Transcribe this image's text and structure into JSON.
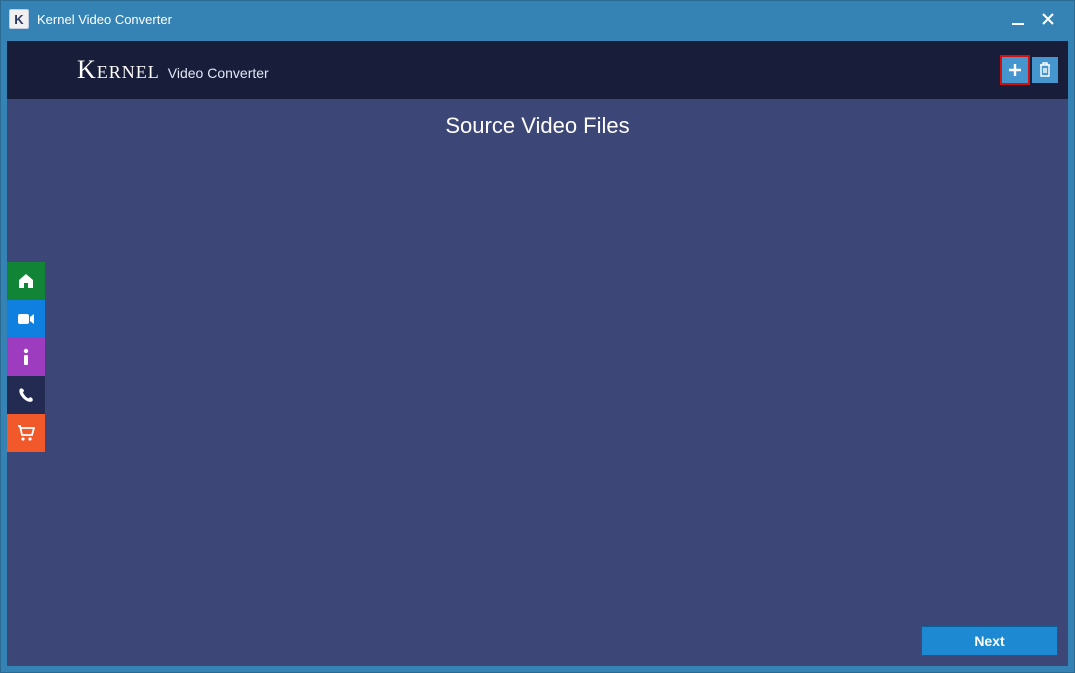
{
  "window": {
    "app_icon_letter": "K",
    "title": "Kernel Video Converter"
  },
  "header": {
    "brand_main": "Kernel",
    "brand_sub": "Video Converter",
    "add_tooltip": "Add files",
    "delete_tooltip": "Delete files"
  },
  "main": {
    "section_title": "Source Video Files"
  },
  "sidebar": {
    "items": [
      {
        "name": "home",
        "color": "green"
      },
      {
        "name": "video",
        "color": "blue"
      },
      {
        "name": "info",
        "color": "purple"
      },
      {
        "name": "support",
        "color": "dark"
      },
      {
        "name": "buy",
        "color": "orange"
      }
    ]
  },
  "footer": {
    "next_label": "Next"
  },
  "colors": {
    "title_bar": "#3583b5",
    "header": "#181d3a",
    "body": "#3d4777",
    "primary_button": "#1d89d2",
    "highlight_outline": "#d31010"
  }
}
